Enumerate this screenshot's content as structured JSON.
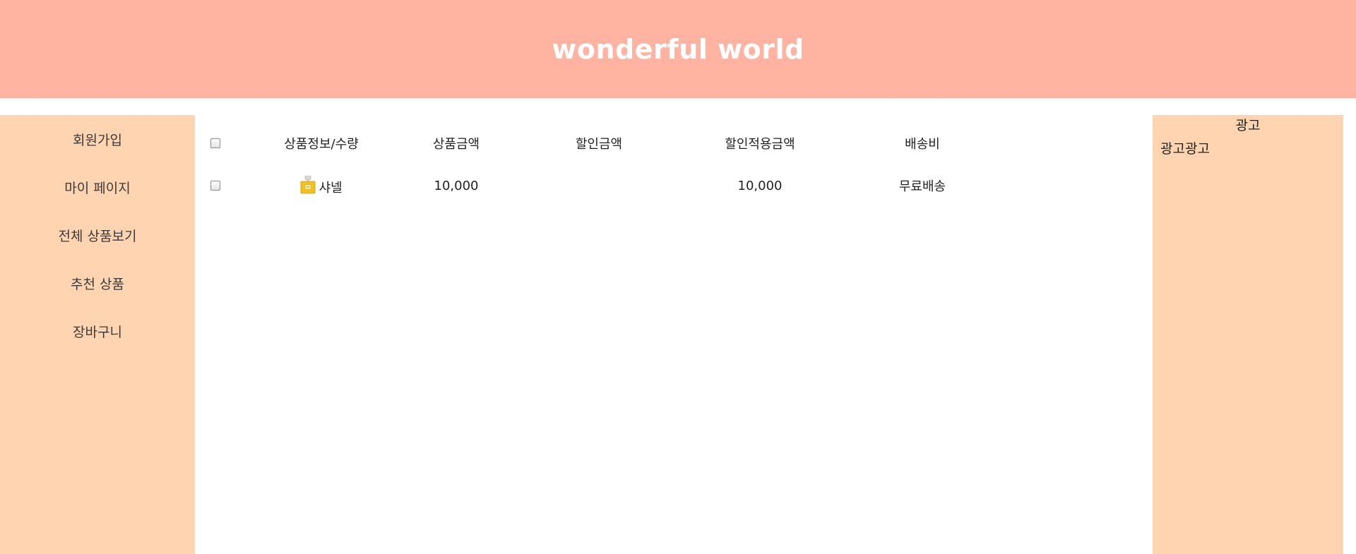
{
  "colors": {
    "header_bg": "#ffb3a0",
    "panel_bg": "#ffd4b0",
    "page_bg": "#ffffff"
  },
  "header": {
    "title": "wonderful world"
  },
  "sidebar": {
    "items": [
      {
        "label": "회원가입"
      },
      {
        "label": "마이 페이지"
      },
      {
        "label": "전체 상품보기"
      },
      {
        "label": "추천 상품"
      },
      {
        "label": "장바구니"
      }
    ]
  },
  "cart": {
    "headers": {
      "product_info": "상품정보/수량",
      "price": "상품금액",
      "discount": "할인금액",
      "discounted_price": "할인적용금액",
      "shipping": "배송비"
    },
    "rows": [
      {
        "product_name": "샤넬",
        "thumbnail_icon": "perfume-bottle-icon",
        "price": "10,000",
        "discount": "",
        "discounted_price": "10,000",
        "shipping": "무료배송"
      }
    ]
  },
  "ad": {
    "title": "광고",
    "body": "광고광고"
  }
}
